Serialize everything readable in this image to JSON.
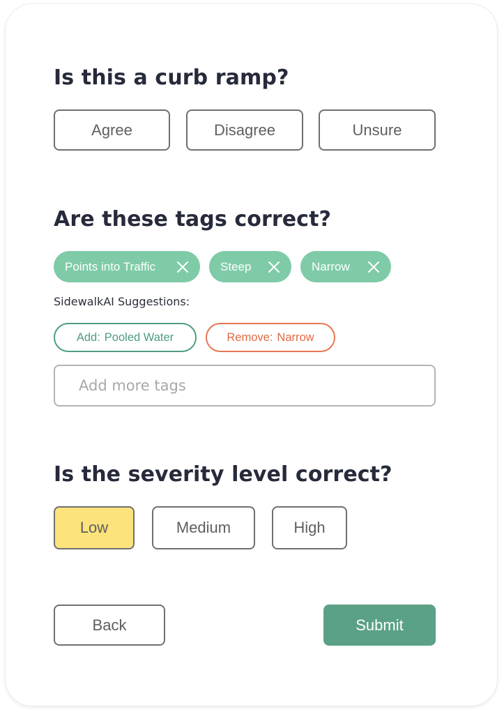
{
  "curb_ramp": {
    "question": "Is this a curb ramp?",
    "options": [
      "Agree",
      "Disagree",
      "Unsure"
    ]
  },
  "tags": {
    "question": "Are these tags correct?",
    "items": [
      "Points into Traffic",
      "Steep",
      "Narrow"
    ],
    "remove_icon": "close-icon",
    "suggestions_label": "SidewalkAI Suggestions:",
    "suggestions": [
      {
        "action": "Add:",
        "tag": "Pooled Water",
        "color": "#4f9d7e"
      },
      {
        "action": "Remove:",
        "tag": "Narrow",
        "color": "#e06a45"
      }
    ],
    "input_placeholder": "Add more tags"
  },
  "severity": {
    "question": "Is the severity level correct?",
    "options": [
      "Low",
      "Medium",
      "High"
    ],
    "selected": "Low",
    "selected_color": "#fce37b"
  },
  "footer": {
    "back_label": "Back",
    "submit_label": "Submit",
    "submit_color": "#5ba185"
  },
  "colors": {
    "tag_fill": "#7fcba8"
  }
}
